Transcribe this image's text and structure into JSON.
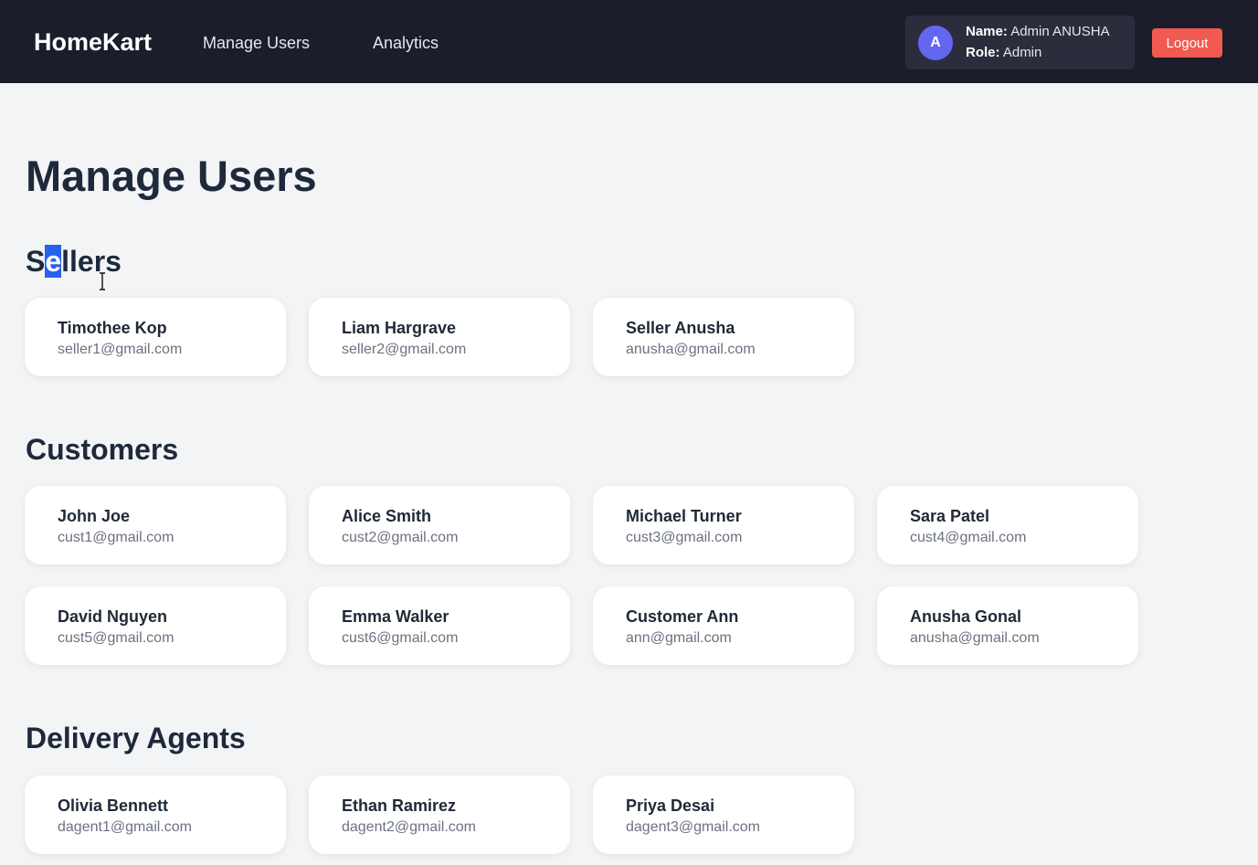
{
  "navbar": {
    "brand": "HomeKart",
    "links": [
      "Manage Users",
      "Analytics"
    ],
    "user": {
      "avatar_letter": "A",
      "name_label": "Name:",
      "name_value": "Admin ANUSHA",
      "role_label": "Role:",
      "role_value": "Admin"
    },
    "logout_label": "Logout"
  },
  "page_title": "Manage Users",
  "sections": {
    "sellers": {
      "title_parts": [
        "S",
        "e",
        "llers"
      ],
      "users": [
        {
          "name": "Timothee Kop",
          "email": "seller1@gmail.com"
        },
        {
          "name": "Liam Hargrave",
          "email": "seller2@gmail.com"
        },
        {
          "name": "Seller Anusha",
          "email": "anusha@gmail.com"
        }
      ]
    },
    "customers": {
      "title": "Customers",
      "users": [
        {
          "name": "John Joe",
          "email": "cust1@gmail.com"
        },
        {
          "name": "Alice Smith",
          "email": "cust2@gmail.com"
        },
        {
          "name": "Michael Turner",
          "email": "cust3@gmail.com"
        },
        {
          "name": "Sara Patel",
          "email": "cust4@gmail.com"
        },
        {
          "name": "David Nguyen",
          "email": "cust5@gmail.com"
        },
        {
          "name": "Emma Walker",
          "email": "cust6@gmail.com"
        },
        {
          "name": "Customer Ann",
          "email": "ann@gmail.com"
        },
        {
          "name": "Anusha Gonal",
          "email": "anusha@gmail.com"
        }
      ]
    },
    "delivery_agents": {
      "title": "Delivery Agents",
      "users": [
        {
          "name": "Olivia Bennett",
          "email": "dagent1@gmail.com"
        },
        {
          "name": "Ethan Ramirez",
          "email": "dagent2@gmail.com"
        },
        {
          "name": "Priya Desai",
          "email": "dagent3@gmail.com"
        }
      ]
    }
  },
  "colors": {
    "navbar_bg": "#1b1d2b",
    "avatar": "#6366f1",
    "logout": "#f05a50",
    "text_selection": "#2563eb"
  }
}
